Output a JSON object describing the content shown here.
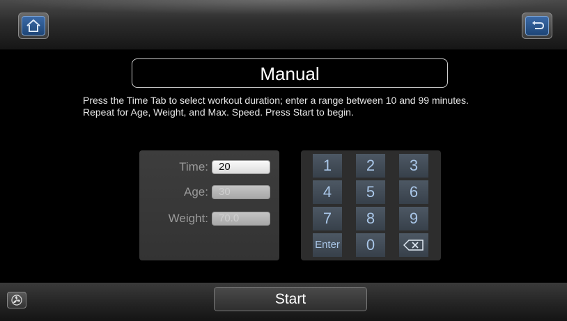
{
  "header": {
    "home_icon": "home-icon",
    "back_icon": "back-arrow-icon",
    "accent": "#2a5590"
  },
  "title": "Manual",
  "instructions": "Press the Time Tab to select workout duration; enter a range between 10 and 99 minutes. Repeat for Age, Weight, and Max. Speed. Press Start to begin.",
  "fields": [
    {
      "label": "Time:",
      "value": "20",
      "active": true
    },
    {
      "label": "Age:",
      "value": "30",
      "active": false
    },
    {
      "label": "Weight:",
      "value": "70.0",
      "active": false
    }
  ],
  "keypad": {
    "keys": [
      "1",
      "2",
      "3",
      "4",
      "5",
      "6",
      "7",
      "8",
      "9",
      "Enter",
      "0"
    ],
    "backspace_icon": "backspace-icon",
    "key_text_color": "#a9c6e8"
  },
  "footer": {
    "start_label": "Start",
    "fan_icon": "fan-icon"
  }
}
